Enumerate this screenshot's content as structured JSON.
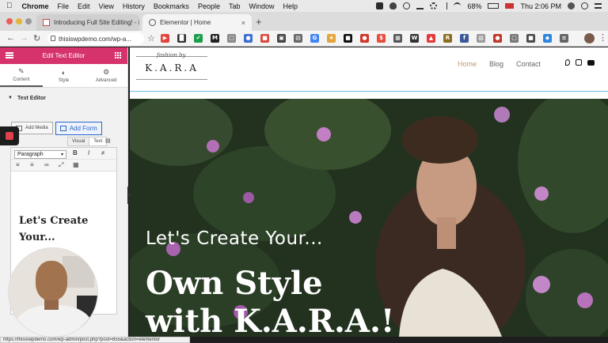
{
  "menubar": {
    "app": "Chrome",
    "items": [
      "File",
      "Edit",
      "View",
      "History",
      "Bookmarks",
      "People",
      "Tab",
      "Window",
      "Help"
    ],
    "battery": "68%",
    "clock": "Thu 2:06 PM"
  },
  "tabs": [
    {
      "title": "Introducing Full Site Editing! - ℹ",
      "favicon": "gmail-icon",
      "active": false
    },
    {
      "title": "Elementor | Home",
      "favicon": "globe-icon",
      "active": true
    }
  ],
  "omnibox": {
    "url": "thisiswpdemo.com/wp-a..."
  },
  "extensions": [
    {
      "name": "ext-1",
      "color": "#e0443c",
      "glyph": "▶"
    },
    {
      "name": "ext-2",
      "color": "#333333",
      "glyph": "█"
    },
    {
      "name": "ext-3",
      "color": "#1b9e4b",
      "glyph": "✔"
    },
    {
      "name": "ext-4",
      "color": "#222222",
      "glyph": "M"
    },
    {
      "name": "ext-5",
      "color": "#888888",
      "glyph": "□"
    },
    {
      "name": "ext-6",
      "color": "#3b6fd1",
      "glyph": "●"
    },
    {
      "name": "ext-7",
      "color": "#d94b3d",
      "glyph": "■"
    },
    {
      "name": "ext-8",
      "color": "#444444",
      "glyph": "▣"
    },
    {
      "name": "ext-9",
      "color": "#666666",
      "glyph": "▤"
    },
    {
      "name": "ext-10",
      "color": "#4285f4",
      "glyph": "G"
    },
    {
      "name": "ext-11",
      "color": "#e5a33b",
      "glyph": "★"
    },
    {
      "name": "ext-12",
      "color": "#111111",
      "glyph": "■"
    },
    {
      "name": "ext-13",
      "color": "#d2352d",
      "glyph": "●"
    },
    {
      "name": "ext-14",
      "color": "#e74c3c",
      "glyph": "$"
    },
    {
      "name": "ext-15",
      "color": "#555555",
      "glyph": "▦"
    },
    {
      "name": "ext-16",
      "color": "#333333",
      "glyph": "W"
    },
    {
      "name": "ext-17",
      "color": "#e33b3b",
      "glyph": "▲"
    },
    {
      "name": "ext-18",
      "color": "#8a6d1e",
      "glyph": "R"
    },
    {
      "name": "ext-19",
      "color": "#3b5998",
      "glyph": "f"
    },
    {
      "name": "ext-20",
      "color": "#999999",
      "glyph": "▧"
    },
    {
      "name": "ext-21",
      "color": "#c0392b",
      "glyph": "●"
    },
    {
      "name": "ext-22",
      "color": "#777777",
      "glyph": "□"
    },
    {
      "name": "ext-23",
      "color": "#4a4a4a",
      "glyph": "■"
    },
    {
      "name": "ext-24",
      "color": "#2e86de",
      "glyph": "◆"
    },
    {
      "name": "ext-25",
      "color": "#666666",
      "glyph": "≡"
    }
  ],
  "panel": {
    "header_title": "Edit Text Editor",
    "tabs": [
      "Content",
      "Style",
      "Advanced"
    ],
    "section_title": "Text Editor",
    "add_media_label": "Add Media",
    "add_form_label": "Add Form",
    "visual_tab": "Visual",
    "text_tab": "Text",
    "format_value": "Paragraph",
    "editor_line1": "Let's Create",
    "editor_line2": "Your..."
  },
  "site": {
    "logo_script": "fashion by",
    "logo_brand": "K.A.R.A",
    "nav": [
      "Home",
      "Blog",
      "Contact"
    ],
    "hero_subtitle": "Let's Create Your...",
    "hero_title_line1": "Own Style",
    "hero_title_line2": "with K.A.R.A.!"
  },
  "statusbar": {
    "url": "https://thisiswpdemo.com/wp-admin/post.php?post=855&action=elementor"
  },
  "colors": {
    "accent": "#d6336c",
    "nav_active": "#c59a6a",
    "edit_line": "#6ec1e4"
  }
}
